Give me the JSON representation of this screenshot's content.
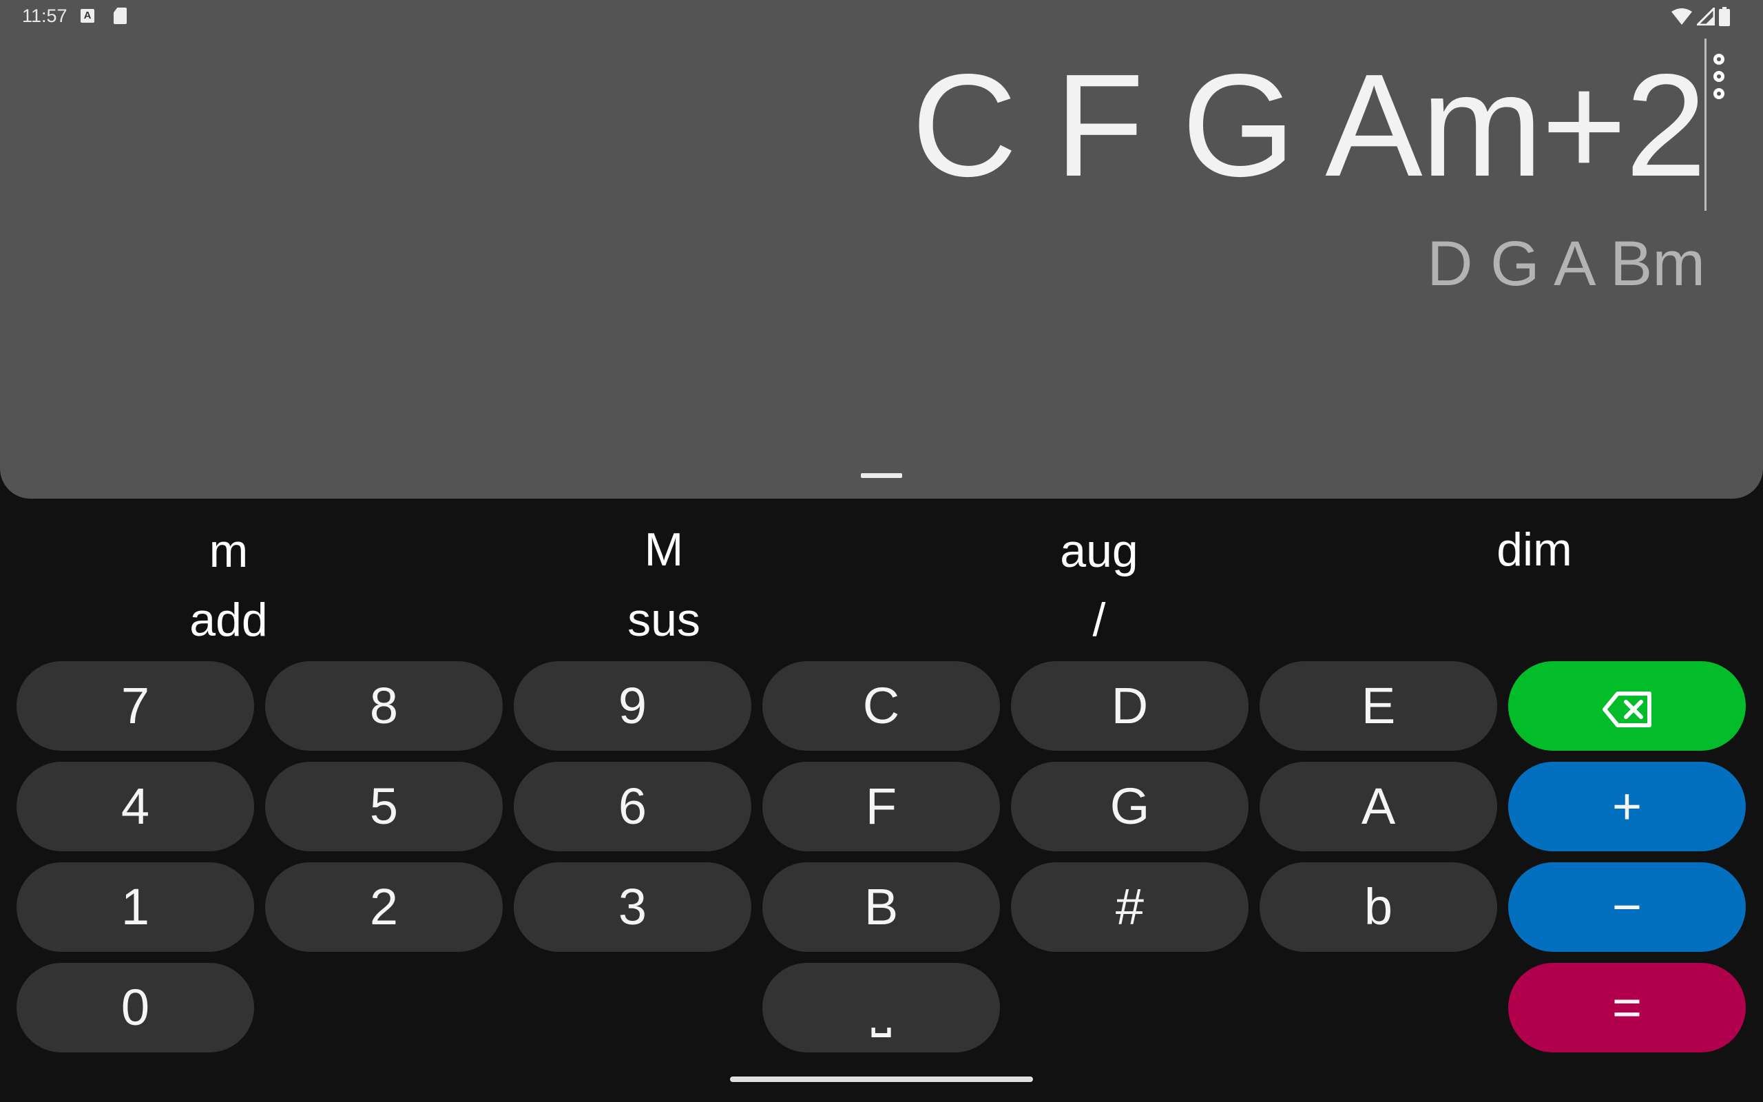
{
  "status_bar": {
    "time": "11:57",
    "notif_icon_letter": "A"
  },
  "display": {
    "expression": "C F G Am+2",
    "result": "D G A Bm"
  },
  "modifiers": {
    "row1": [
      "m",
      "M",
      "aug",
      "dim"
    ],
    "row2": [
      "add",
      "sus",
      "/",
      ""
    ]
  },
  "keypad": {
    "r1": [
      "7",
      "8",
      "9",
      "C",
      "D",
      "E"
    ],
    "r2": [
      "4",
      "5",
      "6",
      "F",
      "G",
      "A"
    ],
    "r3": [
      "1",
      "2",
      "3",
      "B",
      "#",
      "b"
    ],
    "r4": [
      "0",
      "⎵"
    ],
    "plus": "+",
    "minus": "−",
    "equals": "="
  },
  "colors": {
    "backspace": "#02bc2a",
    "operator": "#0270bf",
    "equals": "#b1004c",
    "key": "#333333",
    "display_bg": "#545454"
  }
}
